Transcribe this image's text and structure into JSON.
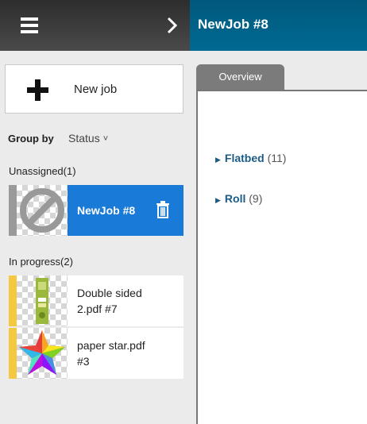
{
  "header": {
    "menu_icon": "hamburger-icon",
    "expand_icon": "chevron-right-icon",
    "title": "NewJob #8"
  },
  "sidebar": {
    "new_job_label": "New job",
    "group_by_label": "Group by",
    "group_by_value": "Status",
    "sections": [
      {
        "title": "Unassigned(1)"
      },
      {
        "title": "In progress(2)"
      }
    ],
    "jobs": [
      {
        "name": "NewJob #8",
        "status": "unassigned",
        "selected": true
      },
      {
        "name": "Double sided 2.pdf #7",
        "status": "in-progress"
      },
      {
        "name": "paper star.pdf #3",
        "status": "in-progress"
      }
    ]
  },
  "main": {
    "tab": "Overview",
    "categories": [
      {
        "name": "Flatbed",
        "count": "(11)"
      },
      {
        "name": "Roll",
        "count": "(9)"
      }
    ]
  },
  "colors": {
    "accent": "#1a7ad8",
    "header_right": "#006a93",
    "in_progress": "#f5c842",
    "unassigned": "#9a9a9a"
  }
}
